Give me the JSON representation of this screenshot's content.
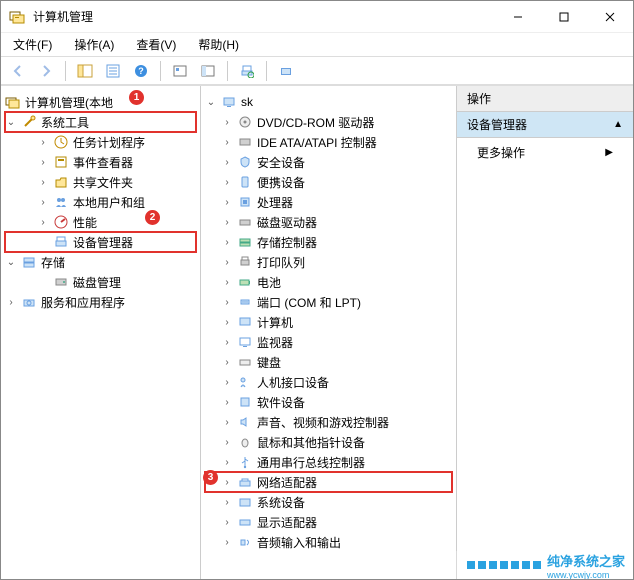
{
  "window": {
    "title": "计算机管理"
  },
  "menu": {
    "file": "文件(F)",
    "action": "操作(A)",
    "view": "查看(V)",
    "help": "帮助(H)"
  },
  "left_tree": {
    "root": "计算机管理(本地",
    "system_tools": "系统工具",
    "task_scheduler": "任务计划程序",
    "event_viewer": "事件查看器",
    "shared_folders": "共享文件夹",
    "local_users": "本地用户和组",
    "performance": "性能",
    "device_manager": "设备管理器",
    "storage": "存储",
    "disk_mgmt": "磁盘管理",
    "services_apps": "服务和应用程序"
  },
  "mid_tree": {
    "root": "sk",
    "dvd": "DVD/CD-ROM 驱动器",
    "ide": "IDE ATA/ATAPI 控制器",
    "security": "安全设备",
    "portable": "便携设备",
    "cpu": "处理器",
    "disk_drive": "磁盘驱动器",
    "storage_ctrl": "存储控制器",
    "print_queue": "打印队列",
    "battery": "电池",
    "ports": "端口 (COM 和 LPT)",
    "computer": "计算机",
    "monitor": "监视器",
    "keyboard": "键盘",
    "hid": "人机接口设备",
    "software_dev": "软件设备",
    "sound": "声音、视频和游戏控制器",
    "mouse": "鼠标和其他指针设备",
    "usb": "通用串行总线控制器",
    "network": "网络适配器",
    "system_dev": "系统设备",
    "display": "显示适配器",
    "audio_io": "音频输入和输出"
  },
  "right": {
    "header": "操作",
    "section": "设备管理器",
    "more": "更多操作"
  },
  "badges": {
    "n1": "1",
    "n2": "2",
    "n3": "3"
  },
  "watermark": {
    "name": "纯净系统之家",
    "url": "www.ycwjy.com"
  }
}
